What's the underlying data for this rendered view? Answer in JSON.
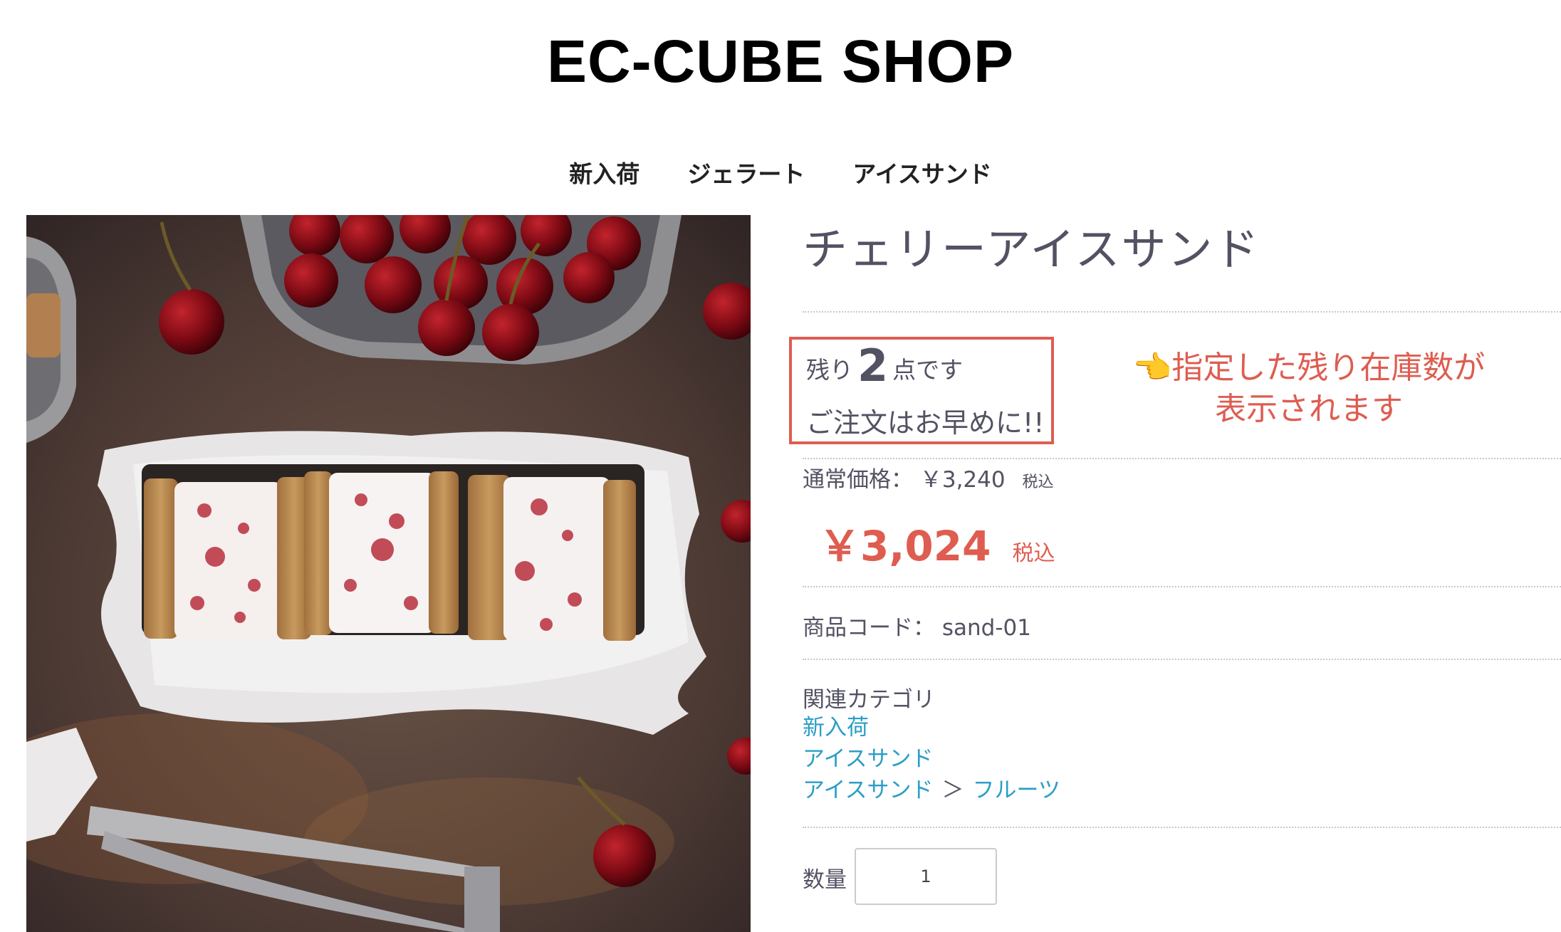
{
  "header": {
    "shop_title": "EC-CUBE SHOP"
  },
  "nav": {
    "items": [
      "新入荷",
      "ジェラート",
      "アイスサンド"
    ]
  },
  "product": {
    "name": "チェリーアイスサンド",
    "stock": {
      "prefix": "残り",
      "count": "2",
      "suffix": "点です",
      "message": "ご注文はお早めに!!"
    },
    "callout": {
      "pointer": "👈",
      "line1": "指定した残り在庫数が",
      "line2": "表示されます"
    },
    "regular_price": {
      "label": "通常価格：",
      "value": "￥3,240",
      "tax": "税込"
    },
    "sale_price": {
      "value": "￥3,024",
      "tax": "税込"
    },
    "code": {
      "label": "商品コード：",
      "value": "sand-01"
    },
    "categories": {
      "title": "関連カテゴリ",
      "links": [
        "新入荷",
        "アイスサンド"
      ],
      "path": [
        "アイスサンド",
        "＞",
        "フルーツ"
      ]
    },
    "quantity": {
      "label": "数量",
      "value": "1"
    }
  },
  "colors": {
    "accent": "#de5d50",
    "link": "#2b9ec7",
    "text": "#525263"
  }
}
